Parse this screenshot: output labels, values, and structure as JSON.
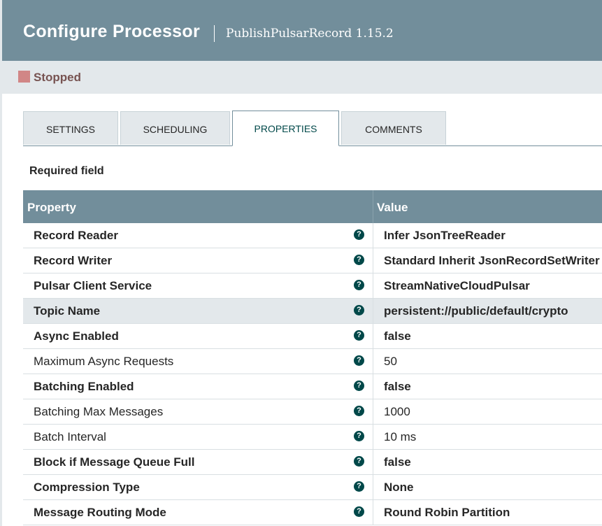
{
  "dialog": {
    "title": "Configure Processor",
    "subtitle": "PublishPulsarRecord 1.15.2"
  },
  "status": {
    "label": "Stopped",
    "color": "#d18686"
  },
  "tabs": [
    {
      "label": "SETTINGS",
      "active": false
    },
    {
      "label": "SCHEDULING",
      "active": false
    },
    {
      "label": "PROPERTIES",
      "active": true
    },
    {
      "label": "COMMENTS",
      "active": false
    }
  ],
  "required_field_label": "Required field",
  "grid": {
    "headers": {
      "property": "Property",
      "value": "Value"
    },
    "rows": [
      {
        "name": "Record Reader",
        "value": "Infer JsonTreeReader",
        "required": true
      },
      {
        "name": "Record Writer",
        "value": "Standard Inherit JsonRecordSetWriter",
        "required": true
      },
      {
        "name": "Pulsar Client Service",
        "value": "StreamNativeCloudPulsar",
        "required": true
      },
      {
        "name": "Topic Name",
        "value": "persistent://public/default/crypto",
        "required": true,
        "selected": true
      },
      {
        "name": "Async Enabled",
        "value": "false",
        "required": true
      },
      {
        "name": "Maximum Async Requests",
        "value": "50",
        "required": false
      },
      {
        "name": "Batching Enabled",
        "value": "false",
        "required": true
      },
      {
        "name": "Batching Max Messages",
        "value": "1000",
        "required": false
      },
      {
        "name": "Batch Interval",
        "value": "10 ms",
        "required": false
      },
      {
        "name": "Block if Message Queue Full",
        "value": "false",
        "required": true
      },
      {
        "name": "Compression Type",
        "value": "None",
        "required": true
      },
      {
        "name": "Message Routing Mode",
        "value": "Round Robin Partition",
        "required": true
      }
    ]
  },
  "help_icon_glyph": "?",
  "colors": {
    "header_bg": "#728e9b",
    "accent": "#004849",
    "stopped": "#d18686"
  }
}
